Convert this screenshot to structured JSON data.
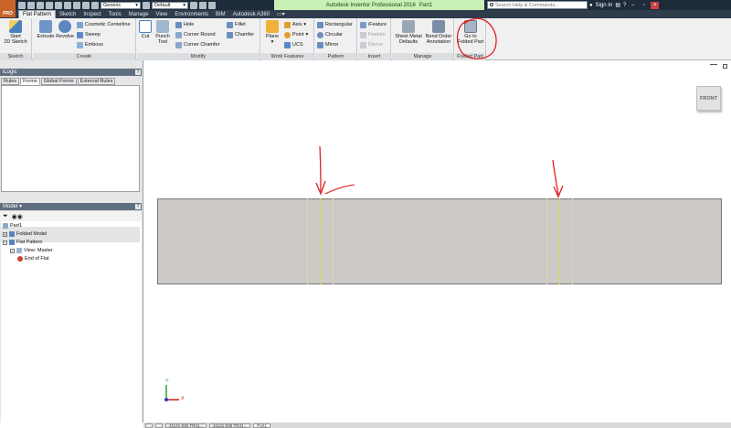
{
  "window": {
    "app_badge": "PRO",
    "title_app": "Autodesk Inventor Professional 2016",
    "title_doc": "Part1",
    "search_placeholder": "Search Help & Commands...",
    "sign_in": "Sign In",
    "appearance_value": "Generic",
    "style_value": "Default"
  },
  "ribbon_tabs": [
    "Flat Pattern",
    "Sketch",
    "Inspect",
    "Tools",
    "Manage",
    "View",
    "Environments",
    "BIM",
    "Autodesk A360"
  ],
  "ribbon": {
    "sketch": {
      "label": "Sketch",
      "start_sketch_line1": "Start",
      "start_sketch_line2": "2D Sketch"
    },
    "create": {
      "label": "Create",
      "extrude": "Extrude",
      "revolve": "Revolve",
      "cosmetic_centerline": "Cosmetic Centerline",
      "sweep": "Sweep",
      "emboss": "Emboss"
    },
    "modify": {
      "label": "Modify",
      "cut": "Cut",
      "punch_line1": "Punch",
      "punch_line2": "Tool",
      "hole": "Hole",
      "fillet": "Fillet",
      "corner_round": "Corner Round",
      "chamfer": "Chamfer",
      "corner_chamfer": "Corner Chamfer"
    },
    "work_features": {
      "label": "Work Features",
      "plane": "Plane",
      "axis": "Axis",
      "point": "Point",
      "ucs": "UCS"
    },
    "pattern": {
      "label": "Pattern",
      "rectangular": "Rectangular",
      "circular": "Circular",
      "mirror": "Mirror"
    },
    "insert": {
      "label": "Insert",
      "ifeature": "iFeature",
      "feature": "Feature",
      "derive": "Derive"
    },
    "manage": {
      "label": "Manage",
      "sheet_metal_line1": "Sheet Metal",
      "sheet_metal_line2": "Defaults",
      "bend_order_line1": "Bend Order",
      "bend_order_line2": "Annotation"
    },
    "folded_part": {
      "label": "Folded Part",
      "go_to_line1": "Go to",
      "go_to_line2": "Folded Part"
    }
  },
  "ilogic": {
    "title": "iLogic",
    "tabs": [
      "Rules",
      "Forms",
      "Global Forms",
      "External Rules"
    ],
    "active_tab": "Forms"
  },
  "model_browser": {
    "title": "Model",
    "tree": {
      "part": "Part1",
      "folded_model": "Folded Model",
      "flat_pattern": "Flat Pattern",
      "view_master": "View: Master",
      "end_of_flat": "End of Flat"
    }
  },
  "viewport": {
    "viewcube_label": "FRONT",
    "triad_x": "X",
    "triad_y": "Y"
  },
  "statusbar": {
    "items": [
      "",
      "",
      "41131-036 TR41...",
      "41131-036 TR41...",
      "Part1"
    ]
  },
  "colors": {
    "annotation": "#e02020",
    "bend_line": "#e6d800",
    "part_fill": "#ccc9c6",
    "title_highlight": "#c8f0b4"
  }
}
